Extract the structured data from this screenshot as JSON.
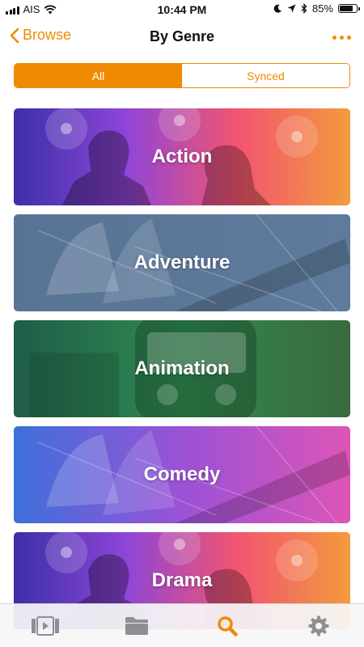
{
  "status_bar": {
    "carrier": "AIS",
    "time": "10:44 PM",
    "battery_text": "85%",
    "battery_level": 0.85,
    "icons": [
      "signal-bars-icon",
      "wifi-icon",
      "moon-icon",
      "location-arrow-icon",
      "bluetooth-icon",
      "battery-icon"
    ]
  },
  "nav": {
    "back_label": "Browse",
    "title": "By Genre",
    "more_icon": "ellipsis-icon"
  },
  "segments": [
    {
      "label": "All",
      "selected": true
    },
    {
      "label": "Synced",
      "selected": false
    }
  ],
  "genres": [
    {
      "label": "Action",
      "colors": [
        "#3b2fa8",
        "#8f45d8",
        "#f2556f",
        "#f39b3c"
      ],
      "art": "concert"
    },
    {
      "label": "Adventure",
      "colors": [
        "#587495",
        "#5f7b9c"
      ],
      "art": "ship"
    },
    {
      "label": "Animation",
      "colors": [
        "#1f5d4a",
        "#2f8a4f",
        "#3a6a3e"
      ],
      "art": "bus"
    },
    {
      "label": "Comedy",
      "colors": [
        "#3d70da",
        "#9a52d6",
        "#dd55b6"
      ],
      "art": "ship"
    },
    {
      "label": "Drama",
      "colors": [
        "#3b2fa8",
        "#8f45d8",
        "#f2556f",
        "#f39b3c"
      ],
      "art": "concert"
    }
  ],
  "tab_bar": [
    {
      "name": "videos",
      "icon": "video-library-icon",
      "active": false
    },
    {
      "name": "files",
      "icon": "folder-icon",
      "active": false
    },
    {
      "name": "browse",
      "icon": "search-icon",
      "active": true
    },
    {
      "name": "settings",
      "icon": "gear-icon",
      "active": false
    }
  ],
  "colors": {
    "accent": "#f08a00",
    "inactive_icon": "#8e8e93"
  }
}
